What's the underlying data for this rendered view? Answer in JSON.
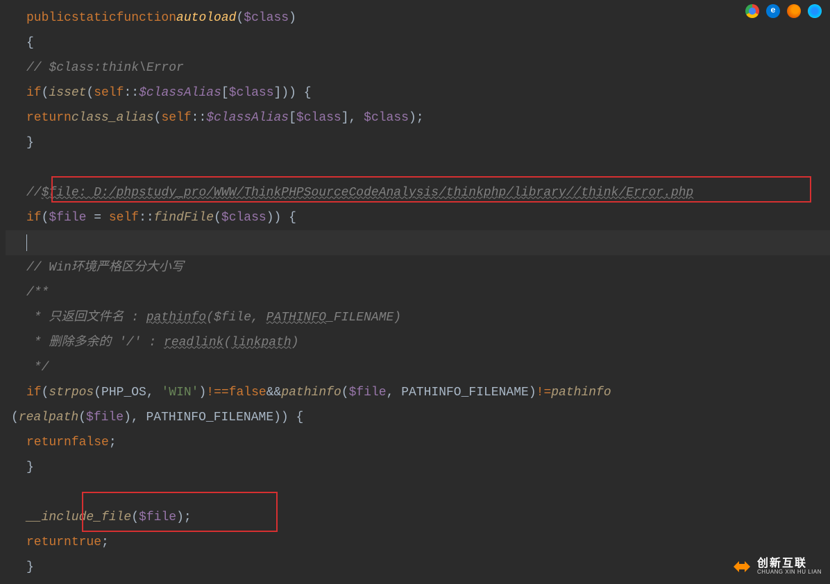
{
  "code": {
    "l1": {
      "public": "public",
      "static": "static",
      "function": "function",
      "name": "autoload",
      "arg": "$class"
    },
    "l2": "{",
    "l3": "// $class:think\\Error",
    "l4": {
      "if": "if",
      "isset": "isset",
      "self": "self",
      "colon": "::",
      "prop": "$classAlias",
      "arg": "$class",
      "end": ")) {"
    },
    "l5": {
      "return": "return",
      "fn": "class_alias",
      "self": "self",
      "colon": "::",
      "prop": "$classAlias",
      "arg1": "$class",
      "arg2": "$class",
      "end": ");"
    },
    "l6": "}",
    "l7": {
      "pre": "//",
      "u": "$file: D:/phpstudy_pro/WWW/ThinkPHPSourceCodeAnalysis/thinkphp/library//think/Error.php"
    },
    "l8": {
      "if": "if",
      "var": "$file",
      "eq": " = ",
      "self": "self",
      "colon": "::",
      "fn": "findFile",
      "arg": "$class",
      "end": ")) {"
    },
    "l9": "// Win环境严格区分大小写",
    "l10": "/**",
    "l11a": " * 只返回文件名 : ",
    "l11b": "pathinfo",
    "l11c": "($file, ",
    "l11d": "PATHINFO",
    "l11e": "_FILENAME)",
    "l12a": " * 删除多余的 '/' : ",
    "l12b": "readlink",
    "l12c": "(",
    "l12d": "linkpath",
    "l12e": ")",
    "l13": " */",
    "l14": {
      "if": "if",
      "strpos": "strpos",
      "phpos": "PHP_OS",
      "win": "'WIN'",
      "neq": "!==",
      "false": "false",
      "and": "&&",
      "pathinfo": "pathinfo",
      "file": "$file",
      "const": "PATHINFO_FILENAME",
      "ne": "!=",
      "pathinfo2": "pathinfo"
    },
    "l15": {
      "realpath": "realpath",
      "file": "$file",
      "const": "PATHINFO_FILENAME",
      "end": ")) {"
    },
    "l16": {
      "return": "return",
      "false": "false"
    },
    "l17": "}",
    "l18": {
      "fn": "__include_file",
      "arg": "$file",
      "end": ");"
    },
    "l19": {
      "return": "return",
      "true": "true"
    },
    "l20": "}"
  },
  "icons": {
    "chrome": "chrome-icon",
    "edge": "e",
    "firefox": "firefox-icon",
    "safari": "safari-icon"
  },
  "watermark": {
    "cn": "创新互联",
    "en": "CHUANG XIN HU LIAN"
  }
}
